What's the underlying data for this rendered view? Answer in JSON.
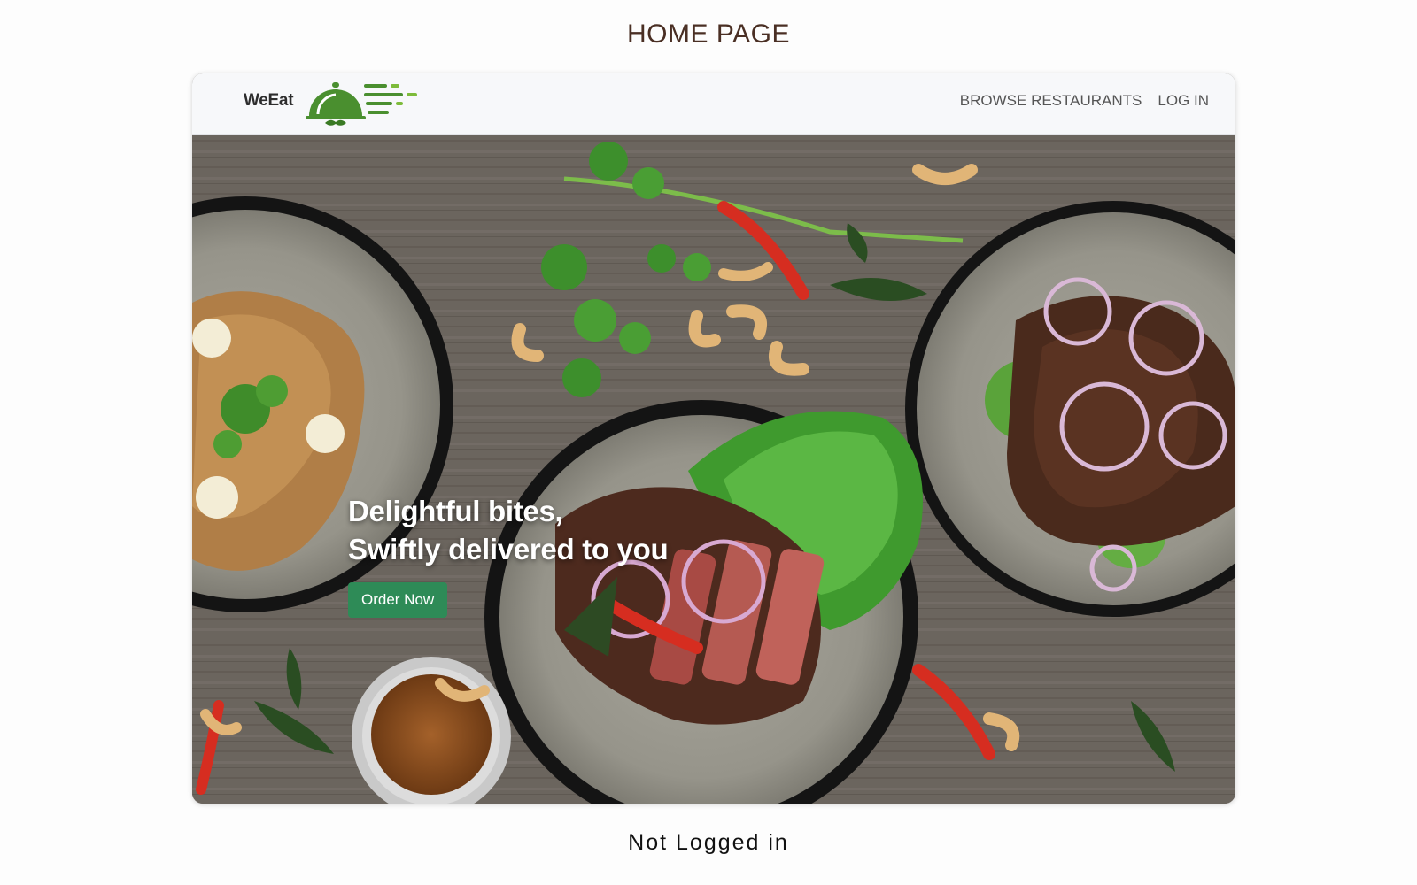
{
  "page": {
    "heading": "HOME PAGE",
    "status": "Not Logged in"
  },
  "navbar": {
    "logo_text": "WeEat",
    "logo_icon": "cloche-delivery-icon",
    "links": [
      "BROWSE RESTAURANTS",
      "LOG IN"
    ]
  },
  "hero": {
    "line1": "Delightful bites,",
    "line2": "Swiftly delivered to you",
    "cta_label": "Order Now",
    "background_image": "food-bowls-on-wooden-table"
  },
  "colors": {
    "accent_green": "#2e8b57",
    "logo_green": "#4a8f2f",
    "heading_brown": "#4a2f24",
    "navbar_bg": "#f7f8fa"
  }
}
